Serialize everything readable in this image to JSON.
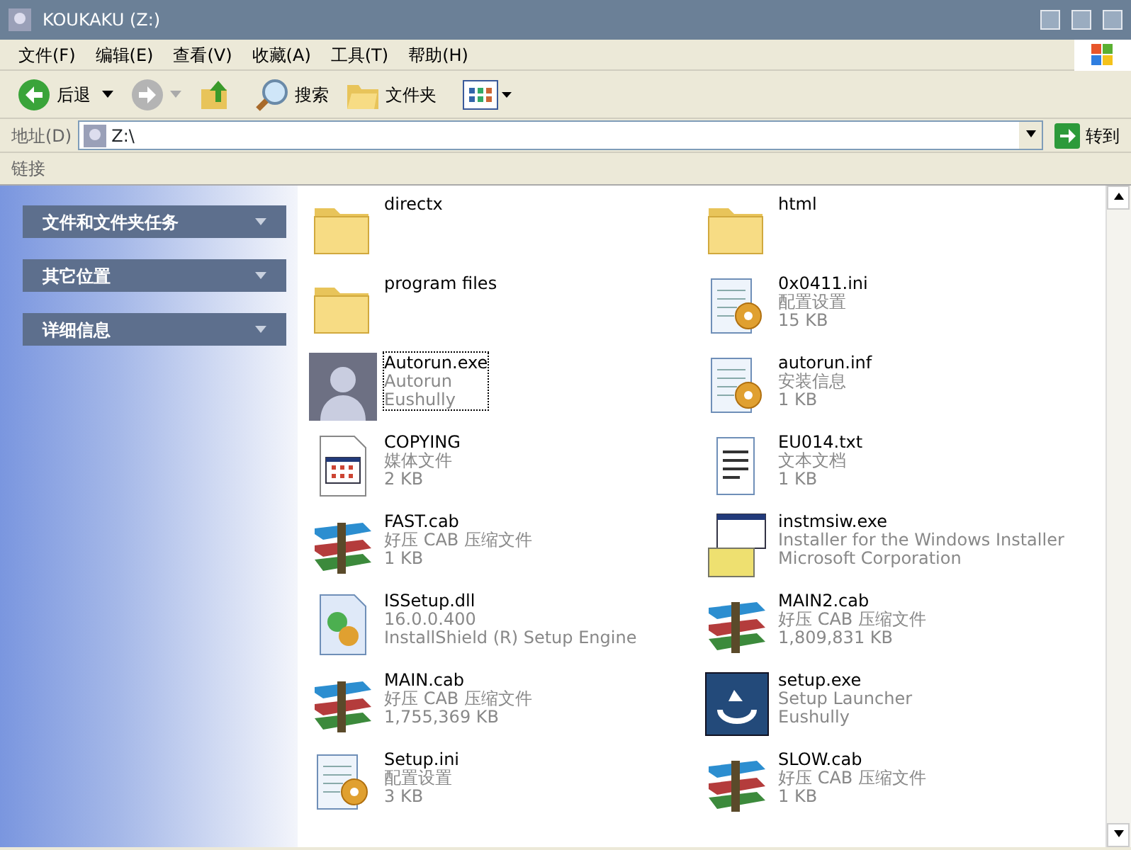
{
  "window": {
    "title": "KOUKAKU (Z:)"
  },
  "menu": [
    "文件(F)",
    "编辑(E)",
    "查看(V)",
    "收藏(A)",
    "工具(T)",
    "帮助(H)"
  ],
  "toolbar": {
    "back": "后退",
    "search": "搜索",
    "folders": "文件夹"
  },
  "address": {
    "label": "地址(D)",
    "value": "Z:\\",
    "go": "转到"
  },
  "links": {
    "label": "链接"
  },
  "sidebar": {
    "items": [
      {
        "label": "文件和文件夹任务",
        "expanded": false
      },
      {
        "label": "其它位置",
        "expanded": false
      },
      {
        "label": "详细信息",
        "expanded": false
      }
    ]
  },
  "files": [
    {
      "kind": "folder",
      "name": "directx",
      "selected": false
    },
    {
      "kind": "folder",
      "name": "html",
      "selected": false
    },
    {
      "kind": "folder",
      "name": "program files",
      "selected": false
    },
    {
      "kind": "ini",
      "name": "0x0411.ini",
      "lines": [
        "配置设置",
        "15 KB"
      ],
      "selected": false
    },
    {
      "kind": "photo",
      "name": "Autorun.exe",
      "lines": [
        "Autorun",
        "Eushully"
      ],
      "selected": true
    },
    {
      "kind": "ini",
      "name": "autorun.inf",
      "lines": [
        "安装信息",
        "1 KB"
      ],
      "selected": false
    },
    {
      "kind": "media",
      "name": "COPYING",
      "lines": [
        "媒体文件",
        "2 KB"
      ],
      "selected": false
    },
    {
      "kind": "txt",
      "name": "EU014.txt",
      "lines": [
        "文本文档",
        "1 KB"
      ],
      "selected": false
    },
    {
      "kind": "cab",
      "name": "FAST.cab",
      "lines": [
        "好压 CAB 压缩文件",
        "1 KB"
      ],
      "selected": false
    },
    {
      "kind": "installer",
      "name": "instmsiw.exe",
      "lines": [
        "Installer for the Windows Installer",
        "Microsoft Corporation"
      ],
      "selected": false
    },
    {
      "kind": "dll",
      "name": "ISSetup.dll",
      "lines": [
        "16.0.0.400",
        "InstallShield (R) Setup Engine"
      ],
      "selected": false
    },
    {
      "kind": "cab",
      "name": "MAIN2.cab",
      "lines": [
        "好压 CAB 压缩文件",
        "1,809,831 KB"
      ],
      "selected": false
    },
    {
      "kind": "cab",
      "name": "MAIN.cab",
      "lines": [
        "好压 CAB 压缩文件",
        "1,755,369 KB"
      ],
      "selected": false
    },
    {
      "kind": "launcher",
      "name": "setup.exe",
      "lines": [
        "Setup Launcher",
        "Eushully"
      ],
      "selected": false
    },
    {
      "kind": "ini",
      "name": "Setup.ini",
      "lines": [
        "配置设置",
        "3 KB"
      ],
      "selected": false
    },
    {
      "kind": "cab",
      "name": "SLOW.cab",
      "lines": [
        "好压 CAB 压缩文件",
        "1 KB"
      ],
      "selected": false
    }
  ]
}
